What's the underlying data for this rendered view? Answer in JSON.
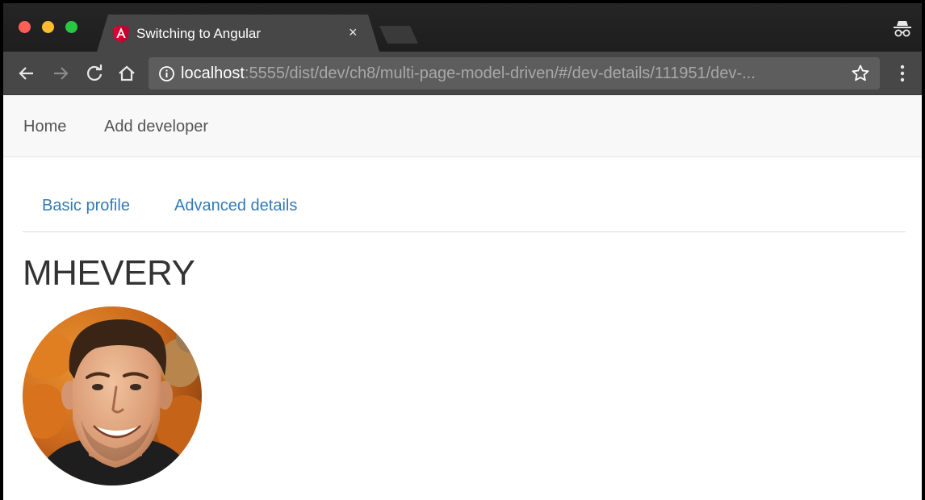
{
  "browser": {
    "tab_title": "Switching to Angular",
    "close_glyph": "×",
    "url_host": "localhost",
    "url_rest": ":5555/dist/dev/ch8/multi-page-model-driven/#/dev-details/111951/dev-...",
    "icons": [
      "back-icon",
      "forward-icon",
      "reload-icon",
      "home-icon",
      "info-icon",
      "star-icon",
      "menu-icon",
      "incognito-icon",
      "angular-logo-icon"
    ]
  },
  "navbar": {
    "home_label": "Home",
    "add_label": "Add developer"
  },
  "tabs": {
    "basic_label": "Basic profile",
    "advanced_label": "Advanced details"
  },
  "developer": {
    "name": "MHEVERY"
  },
  "colors": {
    "link": "#337ab7",
    "navbar_bg": "#f8f8f8",
    "title_bar": "#202124",
    "toolbar": "#474747"
  }
}
